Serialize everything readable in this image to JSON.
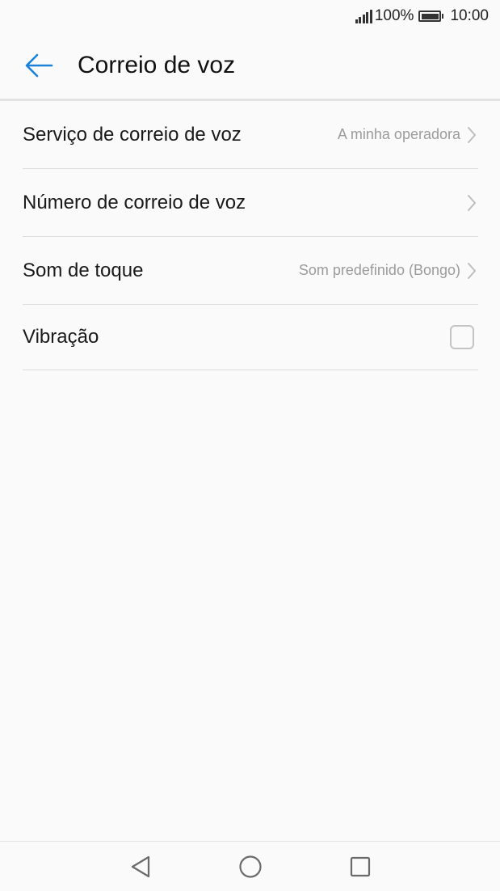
{
  "status_bar": {
    "battery_percent": "100%",
    "time": "10:00",
    "icons": [
      "signal-icon",
      "battery-icon"
    ]
  },
  "app_bar": {
    "title": "Correio de voz",
    "back_icon": "arrow-left-icon",
    "accent_color": "#1a82d8"
  },
  "settings": {
    "voicemail_service": {
      "label": "Serviço de correio de voz",
      "value": "A minha operadora"
    },
    "voicemail_number": {
      "label": "Número de correio de voz"
    },
    "ringtone": {
      "label": "Som de toque",
      "value": "Som predefinido (Bongo)"
    },
    "vibration": {
      "label": "Vibração",
      "checked": false
    }
  },
  "nav_bar": {
    "icons": [
      "back-triangle-icon",
      "home-circle-icon",
      "recents-square-icon"
    ]
  }
}
